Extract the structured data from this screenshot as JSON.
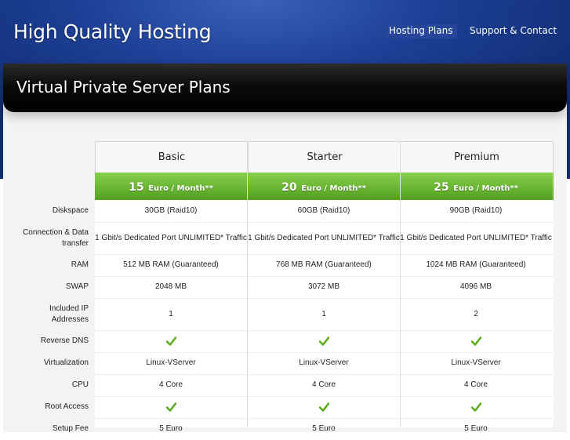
{
  "header": {
    "logo": "High Quality Hosting",
    "nav": [
      "Hosting Plans",
      "Support & Contact"
    ]
  },
  "panel": {
    "title": "Virtual Private Server Plans"
  },
  "plans": [
    {
      "name": "Basic",
      "price_amount": "15",
      "price_unit": "Euro / Month**"
    },
    {
      "name": "Starter",
      "price_amount": "20",
      "price_unit": "Euro / Month**"
    },
    {
      "name": "Premium",
      "price_amount": "25",
      "price_unit": "Euro / Month**"
    }
  ],
  "rows": [
    {
      "label": "Diskspace",
      "values": [
        "30GB (Raid10)",
        "60GB (Raid10)",
        "90GB (Raid10)"
      ]
    },
    {
      "label": "Connection & Data transfer",
      "values": [
        "1 Gbit/s Dedicated Port UNLIMITED* Traffic",
        "1 Gbit/s Dedicated Port UNLIMITED* Traffic",
        "1 Gbit/s Dedicated Port UNLIMITED* Traffic"
      ]
    },
    {
      "label": "RAM",
      "values": [
        "512 MB RAM (Guaranteed)",
        "768 MB RAM (Guaranteed)",
        "1024 MB RAM (Guaranteed)"
      ]
    },
    {
      "label": "SWAP",
      "values": [
        "2048 MB",
        "3072 MB",
        "4096 MB"
      ]
    },
    {
      "label": "Included IP Addresses",
      "values": [
        "1",
        "1",
        "2"
      ]
    },
    {
      "label": "Reverse DNS",
      "values": [
        "check",
        "check",
        "check"
      ]
    },
    {
      "label": "Virtualization",
      "values": [
        "Linux-VServer",
        "Linux-VServer",
        "Linux-VServer"
      ]
    },
    {
      "label": "CPU",
      "values": [
        "4 Core",
        "4 Core",
        "4 Core"
      ]
    },
    {
      "label": "Root Access",
      "values": [
        "check",
        "check",
        "check"
      ]
    },
    {
      "label": "Setup Fee",
      "values": [
        "5 Euro",
        "5 Euro",
        "5 Euro"
      ]
    }
  ],
  "colors": {
    "accent_green": "#5bb02a",
    "header_blue": "#1d3f95",
    "check_green": "#5dad21"
  }
}
